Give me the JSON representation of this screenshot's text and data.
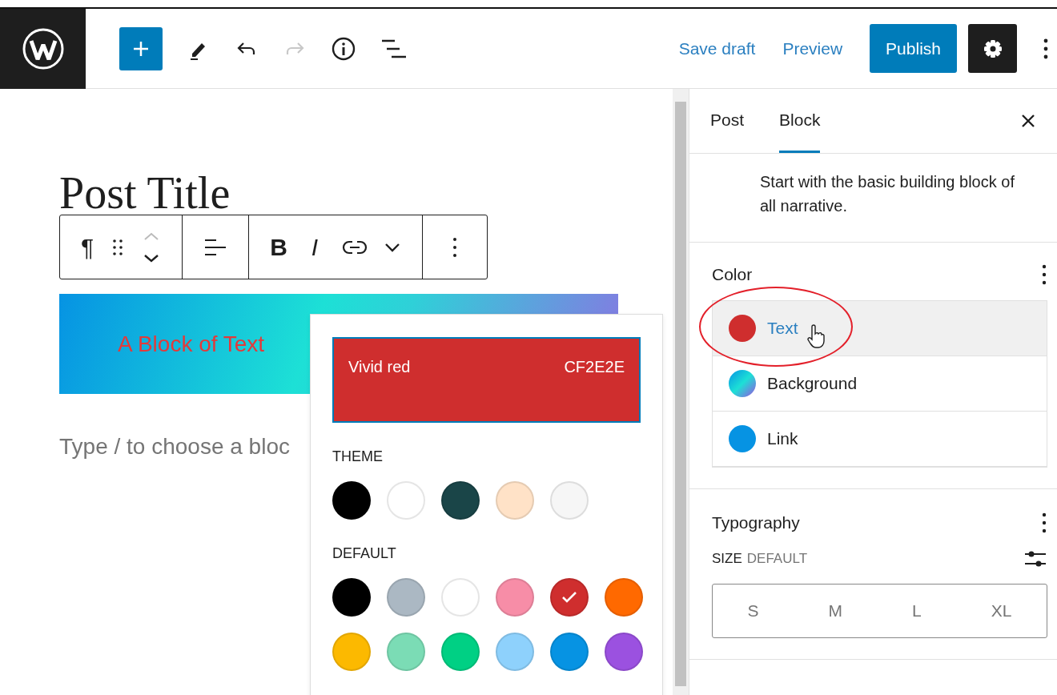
{
  "header": {
    "tools": [
      {
        "kind": "add"
      },
      {
        "kind": "edit"
      },
      {
        "kind": "undo",
        "disabled": false
      },
      {
        "kind": "redo",
        "disabled": true
      },
      {
        "kind": "info"
      },
      {
        "kind": "list-view"
      }
    ],
    "links": [
      "Save draft",
      "Preview"
    ],
    "publish": "Publish",
    "settings": {
      "selected": true
    }
  },
  "editor": {
    "title": "Post Title",
    "toolbar": [
      {
        "items": [
          {
            "kind": "paragraph",
            "label": "¶"
          },
          {
            "kind": "drag"
          },
          {
            "kind": "move"
          }
        ]
      },
      {
        "items": [
          {
            "kind": "align"
          }
        ]
      },
      {
        "items": [
          {
            "kind": "bold",
            "label": "B"
          },
          {
            "kind": "italic",
            "label": "I"
          },
          {
            "kind": "link"
          },
          {
            "kind": "caret"
          }
        ]
      },
      {
        "items": [
          {
            "kind": "options"
          }
        ]
      }
    ],
    "block_text": "A Block of Text",
    "placeholder": "Type / to choose a bloc"
  },
  "popover": {
    "current": {
      "name": "Vivid red",
      "hex": "CF2E2E",
      "color": "#cf2e2e"
    },
    "palettes": [
      {
        "label": "THEME",
        "swatches": [
          {
            "color": "#000000",
            "selected": false
          },
          {
            "color": "#ffffff",
            "selected": false
          },
          {
            "color": "#1a4548",
            "selected": false
          },
          {
            "color": "#ffe2c7",
            "selected": false
          },
          {
            "color": "#f6f6f6",
            "selected": false
          }
        ]
      },
      {
        "label": "DEFAULT",
        "swatches": [
          {
            "color": "#000000",
            "selected": false
          },
          {
            "color": "#abb8c3",
            "selected": false
          },
          {
            "color": "#ffffff",
            "selected": false
          },
          {
            "color": "#f78da7",
            "selected": false
          },
          {
            "color": "#cf2e2e",
            "selected": true
          },
          {
            "color": "#ff6900",
            "selected": false
          },
          {
            "color": "#fcb900",
            "selected": false
          },
          {
            "color": "#7bdcb5",
            "selected": false
          },
          {
            "color": "#00d084",
            "selected": false
          },
          {
            "color": "#8ed1fc",
            "selected": false
          },
          {
            "color": "#0693e3",
            "selected": false
          },
          {
            "color": "#9b51e0",
            "selected": false
          }
        ]
      }
    ]
  },
  "sidebar": {
    "tabs": [
      {
        "label": "Post",
        "selected": false
      },
      {
        "label": "Block",
        "selected": true
      }
    ],
    "description": "Start with the basic building block of all narrative.",
    "color": {
      "title": "Color",
      "items": [
        {
          "label": "Text",
          "kind": "solid",
          "color": "#cf2e2e",
          "selected": true
        },
        {
          "label": "Background",
          "kind": "gradient",
          "selected": false
        },
        {
          "label": "Link",
          "kind": "solid",
          "color": "#0693e3",
          "selected": false
        }
      ]
    },
    "typography": {
      "title": "Typography",
      "size_label": "SIZE",
      "size_value": "DEFAULT",
      "sizes": [
        "S",
        "M",
        "L",
        "XL"
      ]
    }
  }
}
